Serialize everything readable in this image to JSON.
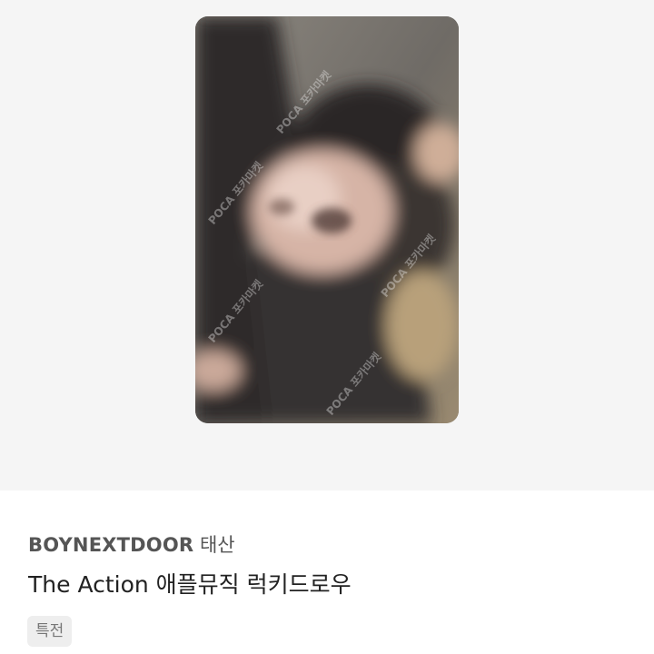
{
  "product": {
    "brand": "BOYNEXTDOOR",
    "member": "태산",
    "subtitle": "The Action 애플뮤직 럭키드로우",
    "tag": "특전",
    "watermark": "POCA 포카마켓"
  },
  "colors": {
    "image_bg": "#f5f5f5",
    "tag_bg": "#eeeeee",
    "text_primary": "#222222",
    "text_secondary": "#555555"
  }
}
